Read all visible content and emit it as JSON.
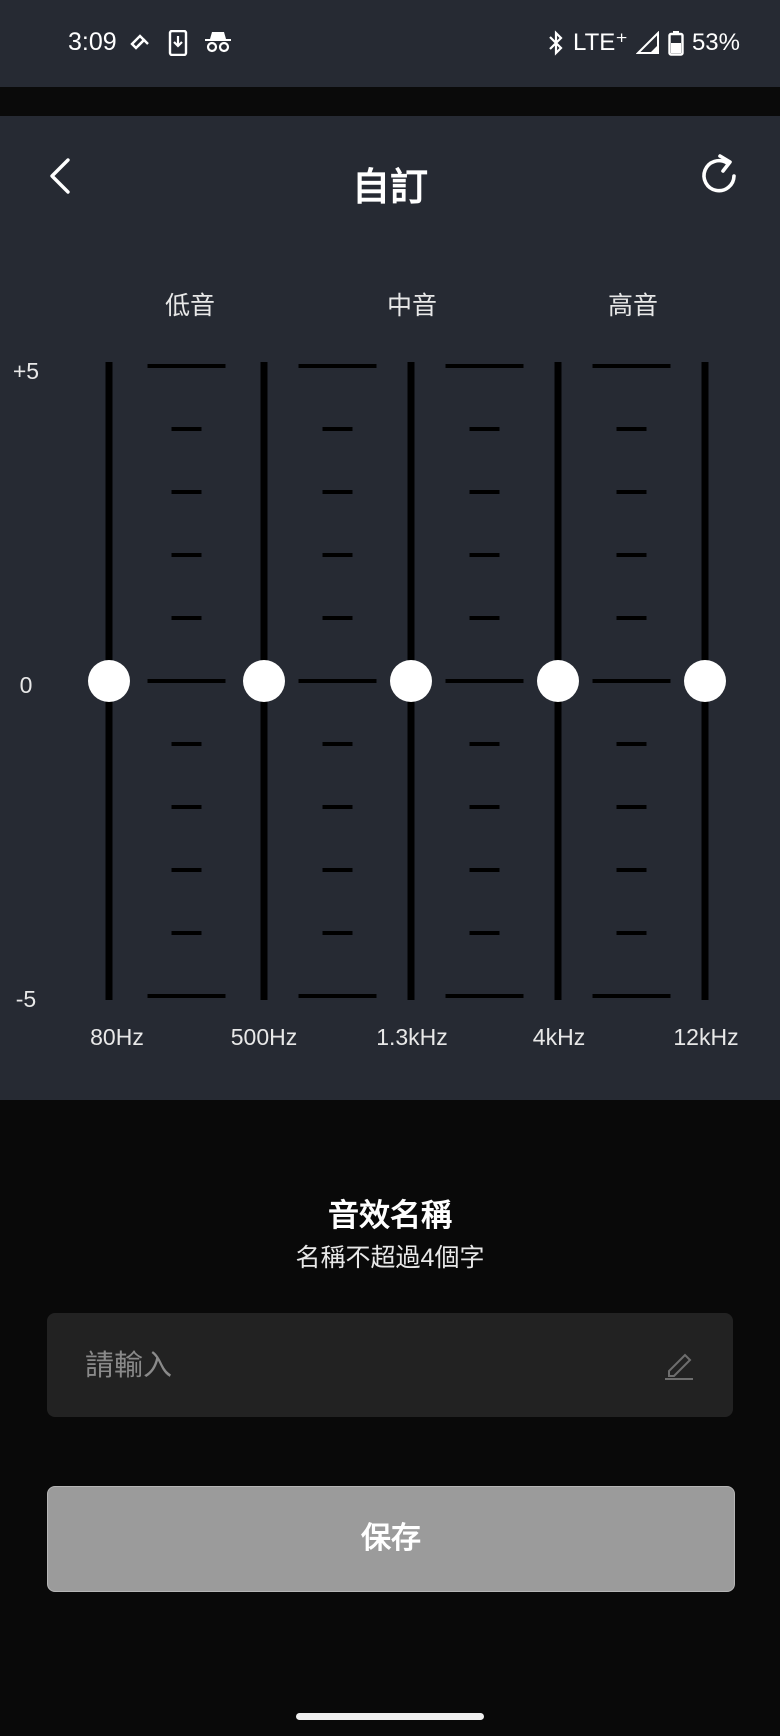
{
  "status_bar": {
    "time": "3:09",
    "left_icons": [
      "drive-sync-icon",
      "download-icon",
      "incognito-icon"
    ],
    "network": "LTE⁺",
    "battery": "53%"
  },
  "header": {
    "title": "自訂"
  },
  "eq": {
    "range_labels": [
      "低音",
      "中音",
      "高音"
    ],
    "y_labels": {
      "top": "+5",
      "middle": "0",
      "bottom": "-5"
    },
    "bands": [
      {
        "label": "80Hz",
        "value": 0
      },
      {
        "label": "500Hz",
        "value": 0
      },
      {
        "label": "1.3kHz",
        "value": 0
      },
      {
        "label": "4kHz",
        "value": 0
      },
      {
        "label": "12kHz",
        "value": 0
      }
    ],
    "min": -5,
    "max": 5
  },
  "preset": {
    "title": "音效名稱",
    "hint": "名稱不超過4個字",
    "input_placeholder": "請輸入",
    "input_value": "",
    "save_label": "保存"
  },
  "colors": {
    "panel_bg": "#262a33",
    "page_bg": "#090909",
    "knob": "#ffffff",
    "track": "#000000",
    "save_disabled": "#9b9b9b"
  }
}
